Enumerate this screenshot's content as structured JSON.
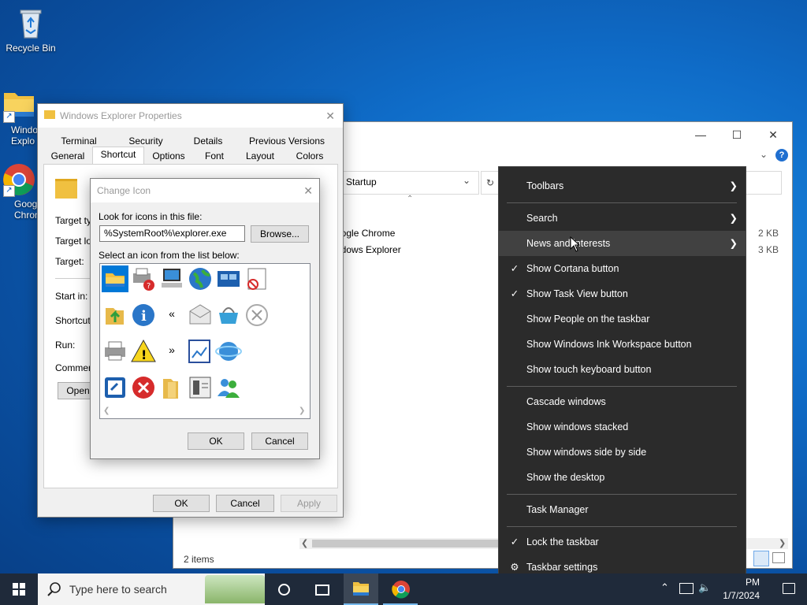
{
  "desktop": {
    "icons": [
      {
        "label": "Recycle Bin"
      },
      {
        "label": "Windows Explorer",
        "label_visible": "Windo\nExplo"
      },
      {
        "label": "Google Chrome",
        "label_visible": "Goog\nChrom"
      }
    ]
  },
  "explorer": {
    "address": "Startup",
    "files": [
      {
        "name": "oogle Chrome",
        "size": "2 KB"
      },
      {
        "name": "ndows Explorer",
        "size": "3 KB"
      }
    ],
    "status": "2 items"
  },
  "properties": {
    "title": "Windows Explorer Properties",
    "tabs_row1": [
      "Terminal",
      "Security",
      "Details",
      "Previous Versions"
    ],
    "tabs_row2": [
      "General",
      "Shortcut",
      "Options",
      "Font",
      "Layout",
      "Colors"
    ],
    "active_tab": "Shortcut",
    "fields": [
      "Target typ",
      "Target loc",
      "Target:",
      "Start in:",
      "Shortcut k",
      "Run:",
      "Comment:"
    ],
    "open_button": "Open",
    "ok": "OK",
    "cancel": "Cancel",
    "apply": "Apply"
  },
  "change_icon": {
    "title": "Change Icon",
    "look_label": "Look for icons in this file:",
    "file_value": "%SystemRoot%\\explorer.exe",
    "browse": "Browse...",
    "select_label": "Select an icon from the list below:",
    "ok": "OK",
    "cancel": "Cancel"
  },
  "context_menu": {
    "items": [
      {
        "label": "Toolbars",
        "submenu": true,
        "checked": false
      },
      {
        "label": "Search",
        "submenu": true,
        "checked": false
      },
      {
        "label": "News and interests",
        "submenu": true,
        "checked": false,
        "hovered": true
      },
      {
        "label": "Show Cortana button",
        "checked": true
      },
      {
        "label": "Show Task View button",
        "checked": true
      },
      {
        "label": "Show People on the taskbar",
        "checked": false
      },
      {
        "label": "Show Windows Ink Workspace button",
        "checked": false
      },
      {
        "label": "Show touch keyboard button",
        "checked": false
      },
      {
        "label": "Cascade windows"
      },
      {
        "label": "Show windows stacked"
      },
      {
        "label": "Show windows side by side"
      },
      {
        "label": "Show the desktop"
      },
      {
        "label": "Task Manager"
      },
      {
        "label": "Lock the taskbar",
        "checked": true
      },
      {
        "label": "Taskbar settings",
        "icon": "gear-icon"
      }
    ]
  },
  "taskbar": {
    "search_placeholder": "Type here to search",
    "time": "PM",
    "date": "1/7/2024"
  },
  "colors": {
    "accent": "#0078d7",
    "menu_bg": "#2b2b2b",
    "taskbar_bg": "#1f2a3a"
  }
}
